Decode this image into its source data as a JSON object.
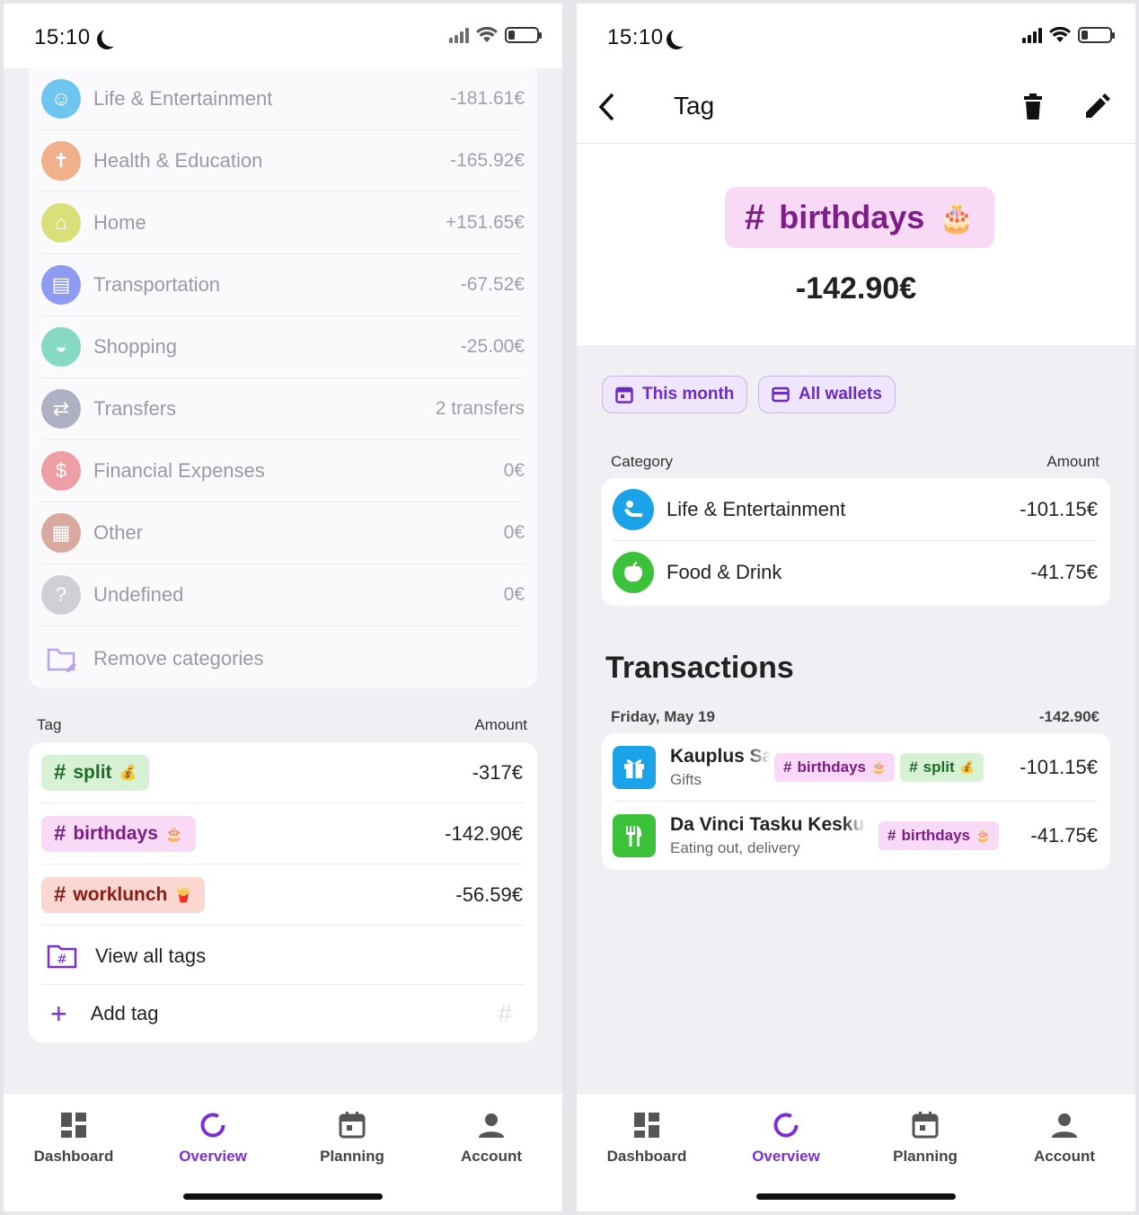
{
  "left": {
    "status": {
      "time": "15:10"
    },
    "categories": [
      {
        "name": "Life & Entertainment",
        "amount": "-181.61€",
        "color": "#6ec6f0",
        "icon": "person-relax-icon"
      },
      {
        "name": "Health & Education",
        "amount": "-165.92€",
        "color": "#f2b08a",
        "icon": "person-icon"
      },
      {
        "name": "Home",
        "amount": "+151.65€",
        "color": "#d9e07a",
        "icon": "home-icon"
      },
      {
        "name": "Transportation",
        "amount": "-67.52€",
        "color": "#8f9bf0",
        "icon": "vehicle-icon"
      },
      {
        "name": "Shopping",
        "amount": "-25.00€",
        "color": "#86d9c3",
        "icon": "basket-icon"
      },
      {
        "name": "Transfers",
        "amount": "2 transfers",
        "color": "#b0b0c4",
        "icon": "transfer-icon"
      },
      {
        "name": "Financial Expenses",
        "amount": "0€",
        "color": "#ee9fa6",
        "icon": "dollar-icon"
      },
      {
        "name": "Other",
        "amount": "0€",
        "color": "#d9a9a0",
        "icon": "grid-icon"
      },
      {
        "name": "Undefined",
        "amount": "0€",
        "color": "#cfcfd6",
        "icon": "question-icon"
      }
    ],
    "remove_categories": "Remove categories",
    "tag_header": {
      "label": "Tag",
      "amount": "Amount"
    },
    "tags": [
      {
        "name": "split",
        "emoji": "💰",
        "amount": "-317€",
        "bg": "#d6f1d3",
        "fg": "#1e6b2a"
      },
      {
        "name": "birthdays",
        "emoji": "🎂",
        "amount": "-142.90€",
        "bg": "#f8d9f6",
        "fg": "#7b1f86"
      },
      {
        "name": "worklunch",
        "emoji": "🍟",
        "amount": "-56.59€",
        "bg": "#fbd7d2",
        "fg": "#8a1c14"
      }
    ],
    "view_all_tags": "View all tags",
    "add_tag": "Add tag"
  },
  "nav": {
    "dashboard": "Dashboard",
    "overview": "Overview",
    "planning": "Planning",
    "account": "Account"
  },
  "right": {
    "status": {
      "time": "15:10"
    },
    "header_title": "Tag",
    "tag": {
      "name": "birthdays",
      "emoji": "🎂",
      "amount": "-142.90€"
    },
    "filters": {
      "period": "This month",
      "wallets": "All wallets"
    },
    "category_header": {
      "label": "Category",
      "amount": "Amount"
    },
    "categories": [
      {
        "name": "Life & Entertainment",
        "amount": "-101.15€",
        "color": "#1aa3e8"
      },
      {
        "name": "Food & Drink",
        "amount": "-41.75€",
        "color": "#3cc13b"
      }
    ],
    "transactions_title": "Transactions",
    "day": {
      "label": "Friday, May 19",
      "total": "-142.90€"
    },
    "transactions": [
      {
        "title": "Kauplus Sa",
        "subtitle": "Gifts",
        "amount": "-101.15€",
        "color": "#1aa3e8",
        "tags": [
          "birthdays",
          "split"
        ]
      },
      {
        "title": "Da Vinci Tasku Keskus",
        "subtitle": "Eating out, delivery",
        "amount": "-41.75€",
        "color": "#3cc13b",
        "tags": [
          "birthdays"
        ]
      }
    ],
    "mini_tag_emojis": {
      "birthdays": "🎂",
      "split": "💰"
    }
  },
  "accent": "#7b2fd6"
}
